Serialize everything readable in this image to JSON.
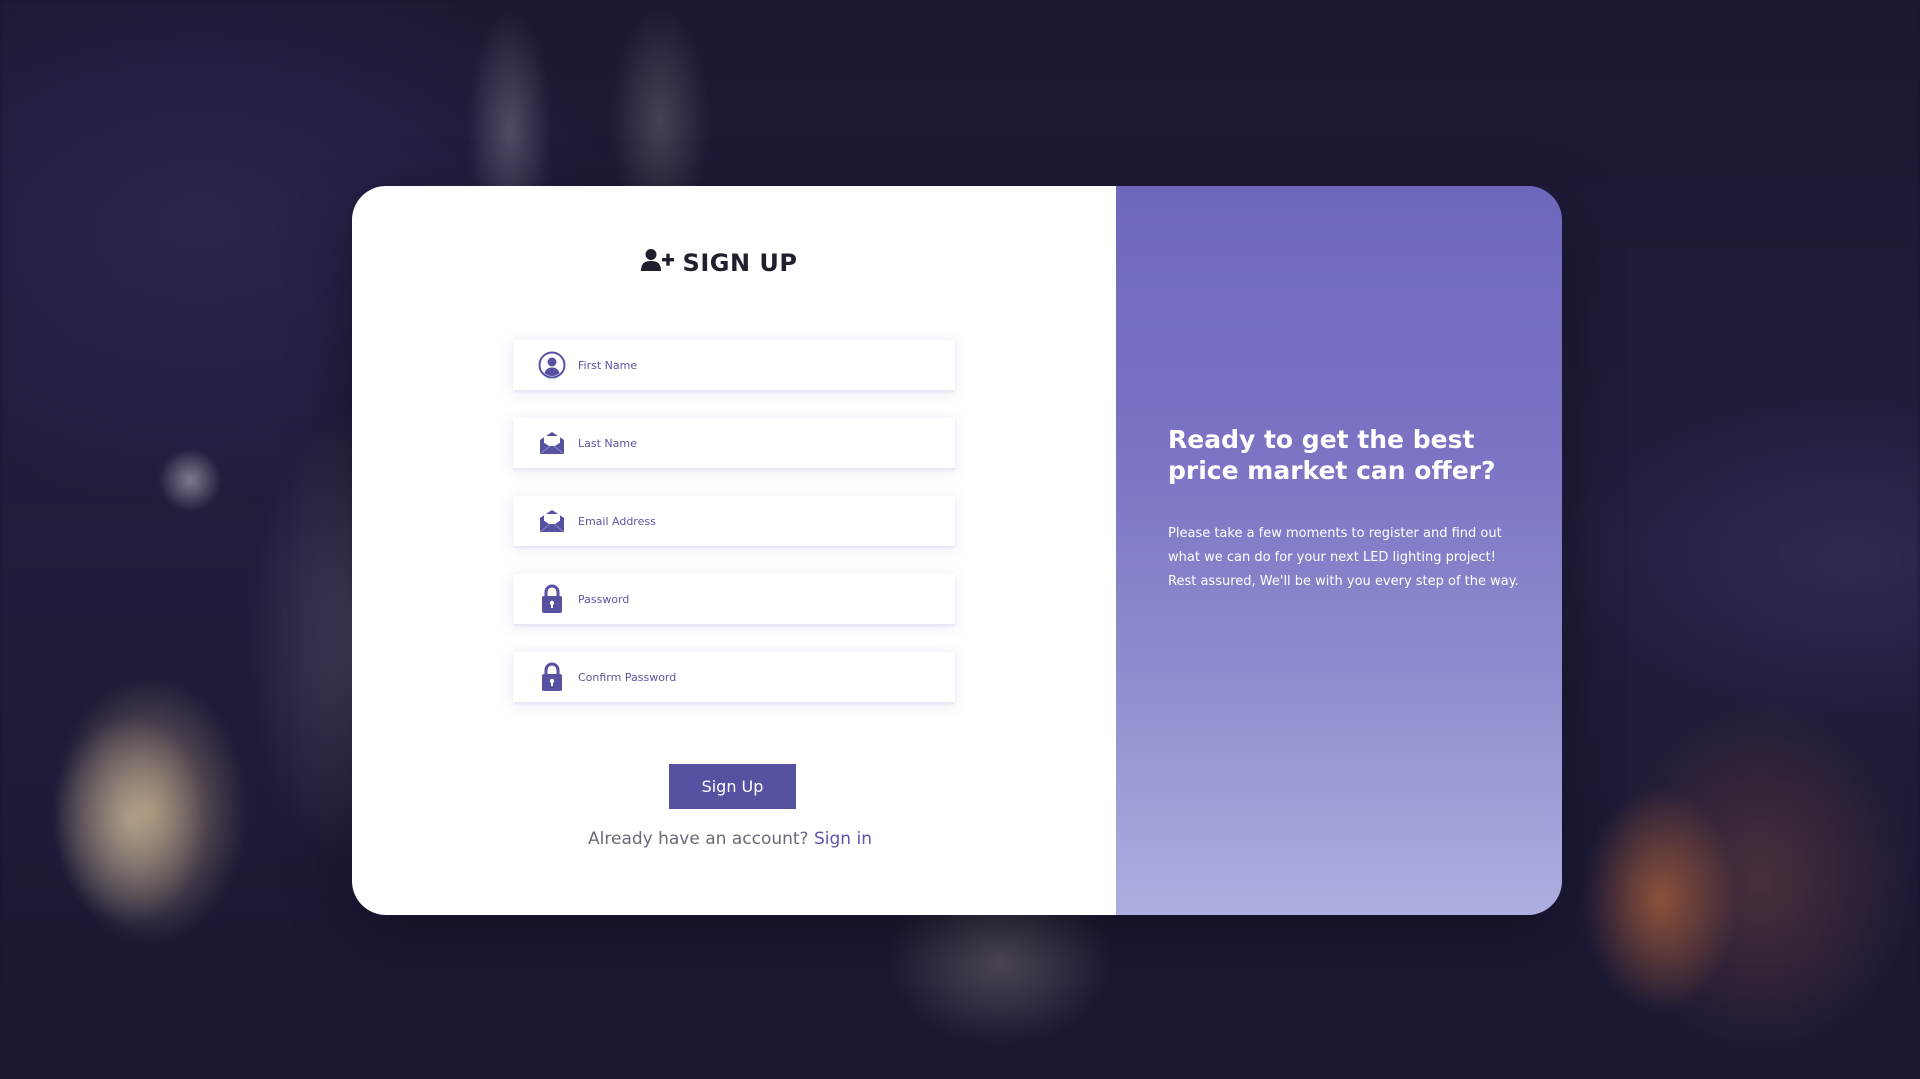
{
  "signup": {
    "title": "SIGN UP",
    "fields": [
      {
        "placeholder": "First Name",
        "icon": "user-circle-icon"
      },
      {
        "placeholder": "Last Name",
        "icon": "envelope-icon"
      },
      {
        "placeholder": "Email Address",
        "icon": "envelope-icon"
      },
      {
        "placeholder": "Password",
        "icon": "lock-icon"
      },
      {
        "placeholder": "Confirm Password",
        "icon": "lock-icon"
      }
    ],
    "submit_label": "Sign Up",
    "signin_prompt": "Already have an account?",
    "signin_link": "Sign in"
  },
  "promo": {
    "heading": "Ready to get the best price market can offer?",
    "text": "Please take a few moments to register and find out what we can do for your next LED lighting project! Rest assured, We'll be with you every step of the way."
  },
  "colors": {
    "accent": "#5652a1",
    "panel_top": "#6e68bd",
    "panel_bottom": "#aeaee0",
    "title": "#1f1f2e"
  },
  "icons": {
    "title_icon": "user-plus-icon"
  }
}
